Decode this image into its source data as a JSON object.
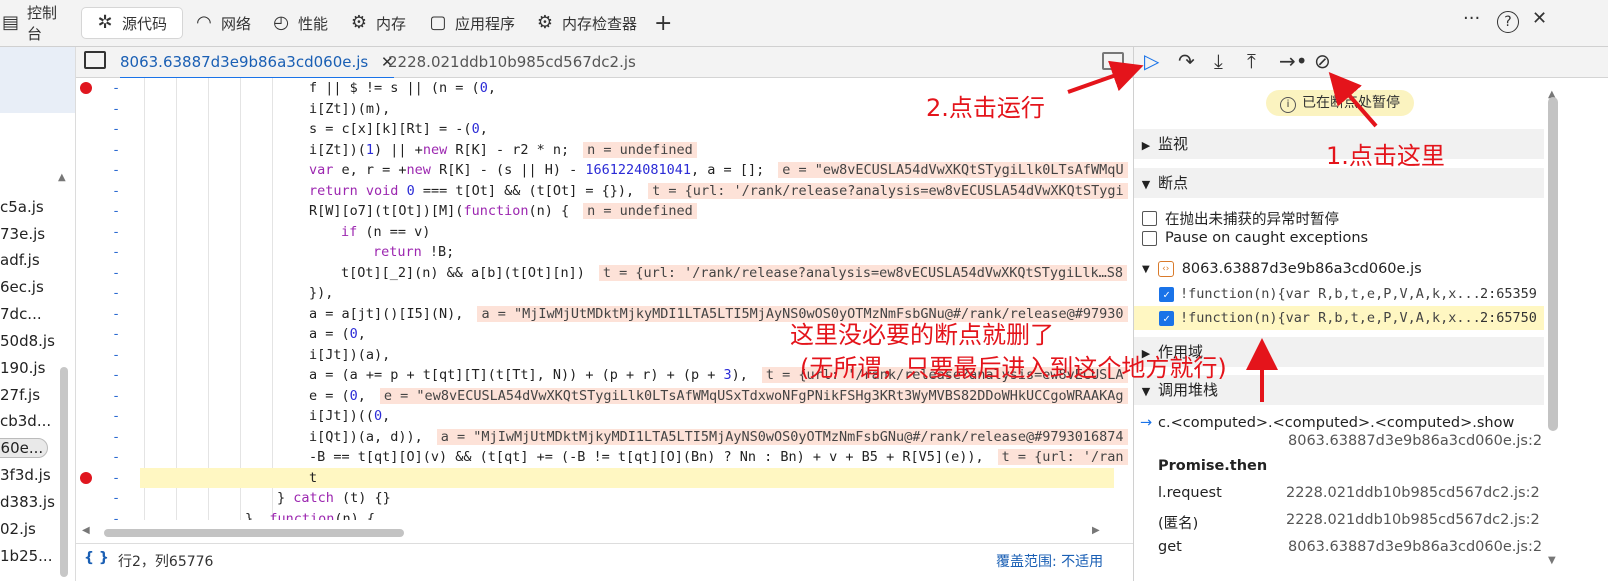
{
  "top_tabs": [
    {
      "label": "控制台",
      "icon": "console-icon"
    },
    {
      "label": "源代码",
      "icon": "bug-icon"
    },
    {
      "label": "网络",
      "icon": "wifi-icon"
    },
    {
      "label": "性能",
      "icon": "gauge-icon"
    },
    {
      "label": "内存",
      "icon": "gear-icon"
    },
    {
      "label": "应用程序",
      "icon": "window-icon"
    },
    {
      "label": "内存检查器",
      "icon": "gear-icon"
    }
  ],
  "add_tab": "+",
  "top_right": {
    "more": "···",
    "help": "?",
    "close": "✕"
  },
  "file_tree": [
    "c5a.js",
    "73e.js",
    "adf.js",
    "6ec.js",
    "7dc...",
    "50d8.js",
    "190.js",
    "27f.js",
    "cb3d...",
    "060e...",
    "3f3d.js",
    "d383.js",
    "02.js",
    "1b25..."
  ],
  "editor_tabs": {
    "active": "8063.63887d3e9b86a3cd060e.js",
    "inactive": "2228.021ddb10b985cd567dc2.js"
  },
  "code_lines": [
    {
      "text": "f || $ != s || (n = (0,",
      "indent": 0,
      "bp": true
    },
    {
      "text": "i[Zt])(m),",
      "indent": 0
    },
    {
      "text": "s = c[x][k][Rt] = -(0,",
      "indent": 0
    },
    {
      "text": "i[Zt])(1) || +new R[K] - r2 * n;",
      "indent": 0,
      "inline": "n = undefined"
    },
    {
      "text": "var e, r = +new R[K] - (s || H) - 1661224081041, a = [];",
      "indent": 0,
      "inline": "e = \"ew8vECUSLA54dVwXKQtSTygiLlk0LTsAfWMqU"
    },
    {
      "text": "return void 0 === t[Ot] && (t[Ot] = {}),",
      "indent": 0,
      "inline": "t = {url: '/rank/release?analysis=ew8vECUSLA54dVwXKQtSTygi"
    },
    {
      "text": "R[W][o7](t[Ot])[M](function(n) {",
      "indent": 0,
      "inline": "n = undefined"
    },
    {
      "text": "if (n == v)",
      "indent": 1
    },
    {
      "text": "return !B;",
      "indent": 2
    },
    {
      "text": "t[Ot][_2](n) && a[b](t[Ot][n])",
      "indent": 1,
      "inline": "t = {url: '/rank/release?analysis=ew8vECUSLA54dVwXKQtSTygiLlk…S8"
    },
    {
      "text": "}),",
      "indent": 0
    },
    {
      "text": "a = a[jt]()[I5](N),",
      "indent": 0,
      "inline": "a = \"MjIwMjUtMDktMjkyMDI1LTA5LTI5MjAyNS0wOS0yOTMzNmFsbGNu@#/rank/release@#97930"
    },
    {
      "text": "a = (0,",
      "indent": 0
    },
    {
      "text": "i[Jt])(a),",
      "indent": 0
    },
    {
      "text": "a = (a += p + t[qt][T](t[Tt], N)) + (p + r) + (p + 3),",
      "indent": 0,
      "inline": "t = {url: '/rank/release?analysis=ew8vECUSLA"
    },
    {
      "text": "e = (0,",
      "indent": 0,
      "inline": "e = \"ew8vECUSLA54dVwXKQtSTygiLlk0LTsAfWMqUSxTdxwoNFgPNikFSHg3KRt3WyMVBS82DDoWHkUCCgoWRAAKAg"
    },
    {
      "text": "i[Jt])((0,",
      "indent": 0
    },
    {
      "text": "i[Qt])(a, d)),",
      "indent": 0,
      "inline": "a = \"MjIwMjUtMDktMjkyMDI1LTA5LTI5MjAyNS0wOS0yOTMzNmFsbGNu@#/rank/release@#9793016874"
    },
    {
      "text": "-B == t[qt][O](v) && (t[qt] += (-B != t[qt][O](Bn) ? Nn : Bn) + v + B5 + R[V5](e)),",
      "indent": 0,
      "inline": "t = {url: '/ran"
    },
    {
      "text": "t",
      "indent": 0,
      "bp": true,
      "current": true
    },
    {
      "text": "} catch (t) {}",
      "indent": -1
    },
    {
      "text": "}, function(n) {",
      "indent": -2
    }
  ],
  "status": {
    "braces": "{ }",
    "position": "行2，列65776",
    "coverage": "覆盖范围: 不适用"
  },
  "right_panel": {
    "paused_text": "已在断点处暂停",
    "sections": {
      "watch": "监视",
      "breakpoints": "断点",
      "scope": "作用域",
      "call_stack": "调用堆栈"
    },
    "pause_options": [
      "在抛出未捕获的异常时暂停",
      "Pause on caught exceptions"
    ],
    "bp_file": "8063.63887d3e9b86a3cd060e.js",
    "bp_items": [
      {
        "code": "!function(n){var R,b,t,e,P,V,A,k,x...",
        "loc": "2:65359"
      },
      {
        "code": "!function(n){var R,b,t,e,P,V,A,k,x...",
        "loc": "2:65750"
      }
    ],
    "stack": [
      {
        "name": "c.<computed>.<computed>.<computed>.show",
        "loc": "8063.63887d3e9b86a3cd060e.js:2"
      },
      {
        "name": "Promise.then",
        "loc": ""
      },
      {
        "name": "l.request",
        "loc": "2228.021ddb10b985cd567dc2.js:2"
      },
      {
        "name": "(匿名)",
        "loc": "2228.021ddb10b985cd567dc2.js:2"
      },
      {
        "name": "get",
        "loc": "8063.63887d3e9b86a3cd060e.js:2"
      }
    ]
  },
  "annotations": {
    "run": "2.点击运行",
    "click_here": "1.点击这里",
    "delete_note_1": "这里没必要的断点就删了",
    "delete_note_2": "(无所谓，只要最后进入到这个地方就行)"
  },
  "colors": {
    "annotation": "#e4141b",
    "breakpoint": "#e0161f",
    "highlight": "#fff7c2",
    "accent": "#1a73e8"
  }
}
